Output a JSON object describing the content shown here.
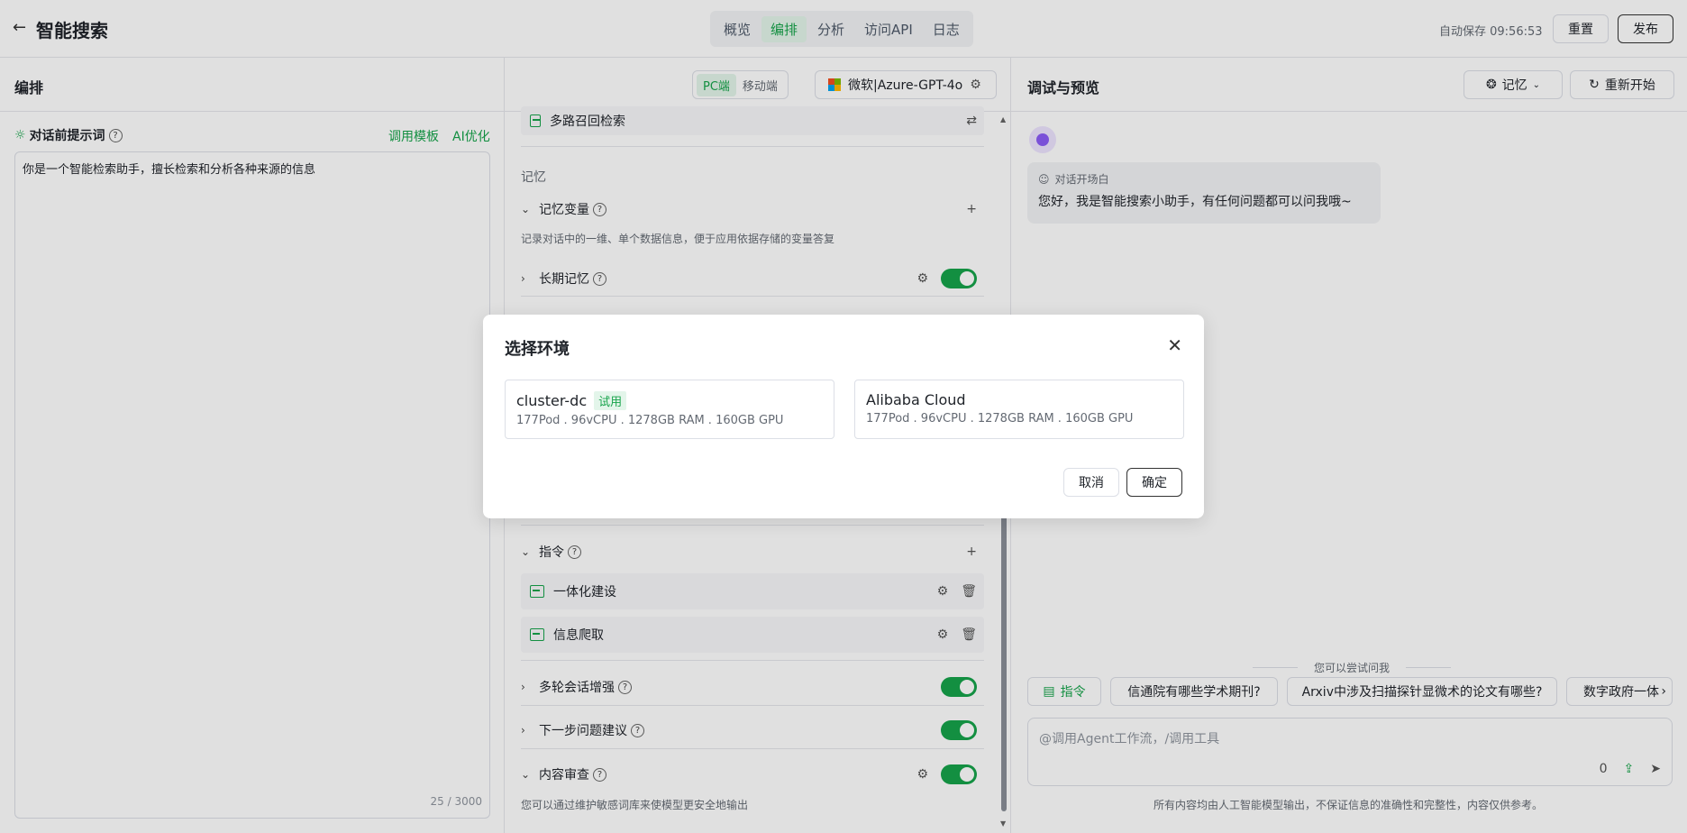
{
  "topbar": {
    "back_icon": "arrow-left-icon",
    "title": "智能搜索",
    "tabs": [
      {
        "label": "概览",
        "active": false
      },
      {
        "label": "编排",
        "active": true
      },
      {
        "label": "分析",
        "active": false
      },
      {
        "label": "访问API",
        "active": false
      },
      {
        "label": "日志",
        "active": false
      }
    ],
    "autosave": "自动保存 09:56:53",
    "reset_label": "重置",
    "publish_label": "发布"
  },
  "arrange": {
    "title": "编排",
    "platform_pc": "PC端",
    "platform_mobile": "移动端",
    "model": "微软|Azure-GPT-4o"
  },
  "prompt": {
    "label": "对话前提示词",
    "help": "?",
    "template_link": "调用模板",
    "ai_link": "AI优化",
    "content": "你是一个智能检索助手，擅长检索和分析各种来源的信息",
    "counter": "25 / 3000"
  },
  "middle": {
    "retrieval_item": "多路召回检索",
    "memory_section": "记忆",
    "memory_var_label": "记忆变量",
    "memory_var_desc": "记录对话中的一维、单个数据信息，便于应用依据存储的变量答复",
    "long_memory_label": "长期记忆",
    "instruction_label": "指令",
    "instructions": [
      "一体化建设",
      "信息爬取"
    ],
    "multi_turn_label": "多轮会话增强",
    "next_question_label": "下一步问题建议",
    "content_review_label": "内容审查",
    "content_review_desc": "您可以通过维护敏感词库来使模型更安全地输出"
  },
  "preview": {
    "title": "调试与预览",
    "memory_btn": "记忆",
    "restart_btn": "重新开始",
    "opening_tag": "对话开场白",
    "opening_text": "您好，我是智能搜索小助手，有任何问题都可以问我哦~",
    "try_label": "您可以尝试问我",
    "chips": [
      "指令",
      "信通院有哪些学术期刊?",
      "Arxiv中涉及扫描探针显微术的论文有哪些?",
      "数字政府一体"
    ],
    "input_placeholder": "@调用Agent工作流，/调用工具",
    "input_count": "0",
    "disclaimer": "所有内容均由人工智能模型输出，不保证信息的准确性和完整性，内容仅供参考。"
  },
  "modal": {
    "title": "选择环境",
    "close_icon": "close-icon",
    "envs": [
      {
        "name": "cluster-dc",
        "badge": "试用",
        "specs": "177Pod .  96vCPU .  1278GB RAM .  160GB GPU"
      },
      {
        "name": "Alibaba Cloud",
        "badge": "",
        "specs": "177Pod .  96vCPU .  1278GB RAM .  160GB GPU"
      }
    ],
    "cancel_label": "取消",
    "confirm_label": "确定"
  },
  "colors": {
    "accent": "#16a34a",
    "accent_bg": "#e3f5ea"
  }
}
